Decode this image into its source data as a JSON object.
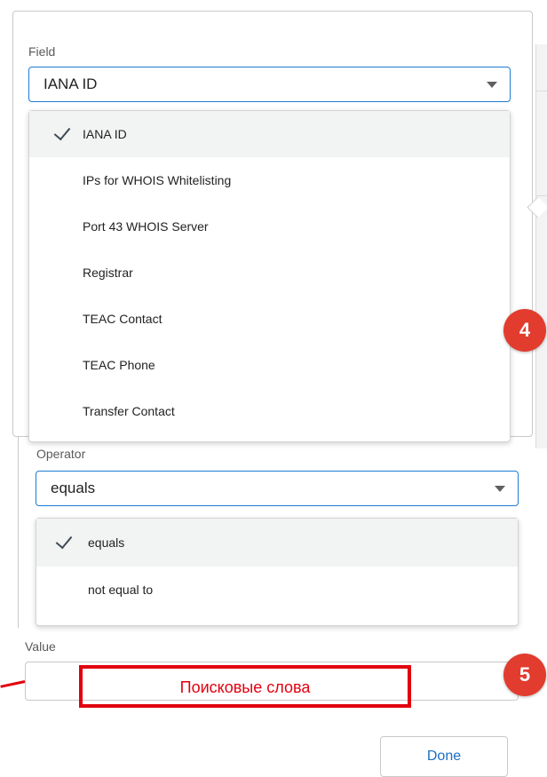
{
  "field": {
    "label": "Field",
    "selected": "IANA ID",
    "options": [
      "IANA ID",
      "IPs for WHOIS Whitelisting",
      "Port 43 WHOIS Server",
      "Registrar",
      "TEAC Contact",
      "TEAC Phone",
      "Transfer Contact"
    ],
    "selected_index": 0
  },
  "operator": {
    "label": "Operator",
    "selected": "equals",
    "options": [
      "equals",
      "not equal to"
    ],
    "selected_index": 0
  },
  "value": {
    "label": "Value",
    "current": ""
  },
  "annotations": {
    "badge_4": "4",
    "badge_5": "5",
    "search_words": "Поисковые слова"
  },
  "actions": {
    "done_label": "Done"
  },
  "colors": {
    "accent_border": "#1b7bd3",
    "badge_red": "#e23c2e",
    "annotation_red": "#e2000d",
    "done_text": "#1b6ec2",
    "selected_row": "#f2f3f3"
  },
  "icons": {
    "caret": "caret-down-icon",
    "check": "check-icon"
  }
}
